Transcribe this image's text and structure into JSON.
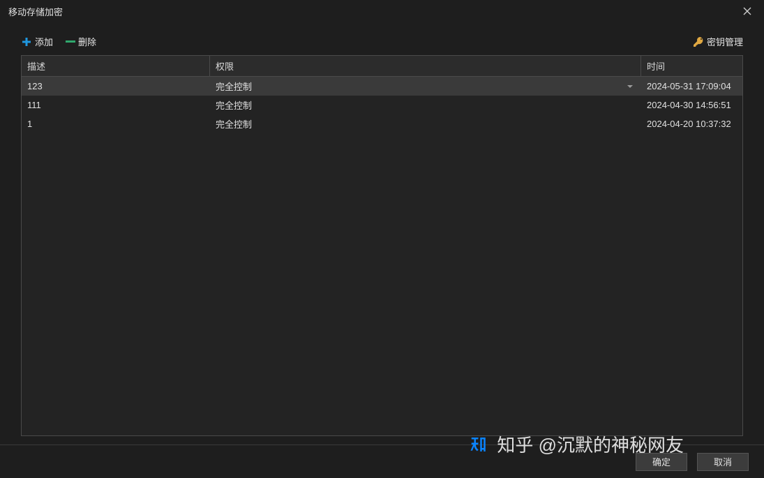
{
  "window": {
    "title": "移动存储加密"
  },
  "toolbar": {
    "add_label": "添加",
    "remove_label": "删除",
    "key_mgmt_label": "密钥管理"
  },
  "table": {
    "headers": {
      "desc": "描述",
      "perm": "权限",
      "time": "时间"
    },
    "rows": [
      {
        "desc": "123",
        "perm": "完全控制",
        "time": "2024-05-31 17:09:04",
        "selected": true
      },
      {
        "desc": "111",
        "perm": "完全控制",
        "time": "2024-04-30 14:56:51",
        "selected": false
      },
      {
        "desc": "1",
        "perm": "完全控制",
        "time": "2024-04-20 10:37:32",
        "selected": false
      }
    ]
  },
  "footer": {
    "ok_label": "确定",
    "cancel_label": "取消"
  },
  "watermark": {
    "text": "知乎 @沉默的神秘网友"
  }
}
